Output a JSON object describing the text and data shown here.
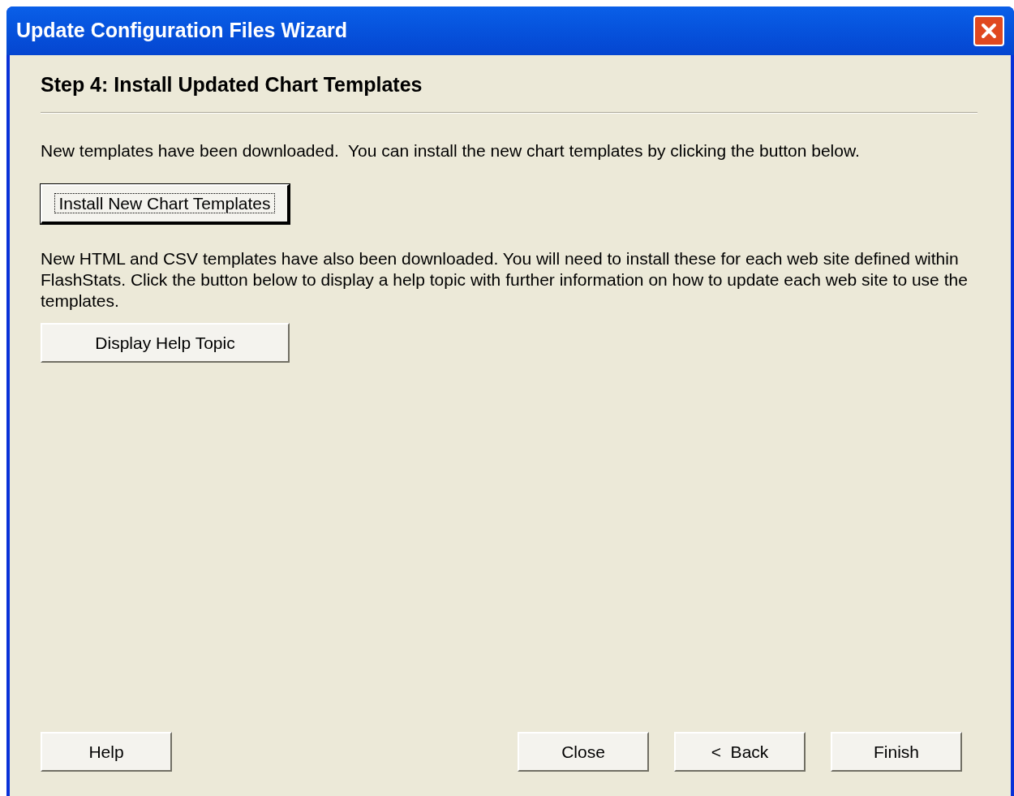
{
  "window": {
    "title": "Update Configuration Files Wizard"
  },
  "step_title": "Step 4: Install Updated Chart Templates",
  "intro_text": "New templates have been downloaded.  You can install the new chart templates by clicking the button below.",
  "install_button": {
    "label": "Install New Chart Templates",
    "focused": true
  },
  "help_text": "New HTML and CSV templates have also been downloaded. You will need to install these for each web site defined within FlashStats. Click the button below to display a help topic with further information on how to update each web site to use the templates.",
  "help_topic_button": {
    "label": "Display Help Topic",
    "focused": false
  },
  "footer_buttons": [
    {
      "label": "Help",
      "focused": false
    },
    {
      "label": "Close",
      "focused": false
    },
    {
      "label": "<  Back",
      "focused": false
    },
    {
      "label": "Finish",
      "focused": false
    }
  ]
}
